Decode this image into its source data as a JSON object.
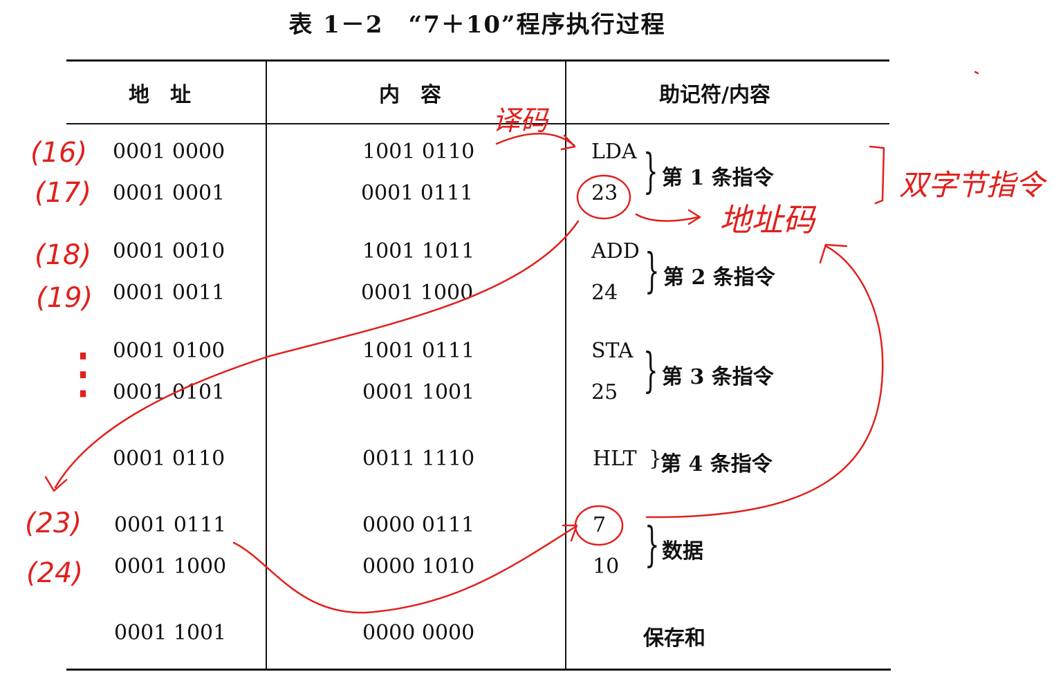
{
  "caption": "表 1－2　“7＋10”程序执行过程",
  "headers": {
    "address": "地　址",
    "content": "内　容",
    "mnemonic": "助记符/内容"
  },
  "rows": [
    {
      "address": "0001 0000",
      "content": "1001 0110",
      "mnemonic": "LDA"
    },
    {
      "address": "0001 0001",
      "content": "0001 0111",
      "mnemonic": "23"
    },
    {
      "address": "0001 0010",
      "content": "1001 1011",
      "mnemonic": "ADD"
    },
    {
      "address": "0001 0011",
      "content": "0001 1000",
      "mnemonic": "24"
    },
    {
      "address": "0001 0100",
      "content": "1001 0111",
      "mnemonic": "STA"
    },
    {
      "address": "0001 0101",
      "content": "0001 1001",
      "mnemonic": "25"
    },
    {
      "address": "0001 0110",
      "content": "0011 1110",
      "mnemonic": "HLT"
    },
    {
      "address": "0001 0111",
      "content": "0000 0111",
      "mnemonic": "7"
    },
    {
      "address": "0001 1000",
      "content": "0000 1010",
      "mnemonic": "10"
    },
    {
      "address": "0001 1001",
      "content": "0000 0000",
      "mnemonic": ""
    }
  ],
  "groups": [
    {
      "label": "第 1 条指令"
    },
    {
      "label": "第 2 条指令"
    },
    {
      "label": "第 3 条指令"
    },
    {
      "label": "第 4 条指令"
    },
    {
      "label": "数据"
    },
    {
      "label": "保存和"
    }
  ],
  "handwriting": {
    "row_numbers": [
      "(16)",
      "(17)",
      "(18)",
      "(19)",
      "(23)",
      "(24)"
    ],
    "ellipsis": "⋮",
    "decode": "译码",
    "address_code": "地址码",
    "two_byte_instruction": "双字节指令"
  },
  "colors": {
    "ink": "#111111",
    "annotation": "#e0201c"
  }
}
